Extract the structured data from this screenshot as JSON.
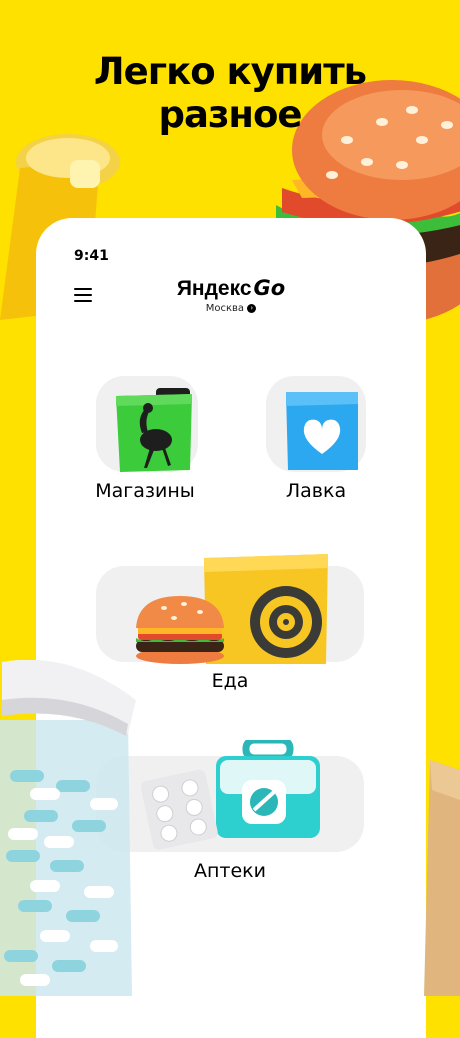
{
  "headline": {
    "line1": "Легко купить",
    "line2": "разное"
  },
  "status": {
    "time": "9:41"
  },
  "header": {
    "brand_name": "Яндекс",
    "brand_suffix": "Go",
    "city": "Москва"
  },
  "services": [
    {
      "id": "stores",
      "label": "Магазины"
    },
    {
      "id": "lavka",
      "label": "Лавка"
    },
    {
      "id": "food",
      "label": "Еда"
    },
    {
      "id": "pharmacy",
      "label": "Аптеки"
    }
  ],
  "colors": {
    "brand_yellow": "#FFE100",
    "tile_bg": "#F0F0F1",
    "stores_green": "#3BCB3B",
    "lavka_blue": "#2CA8F1",
    "pharmacy_teal": "#2ECFCF"
  },
  "icons": [
    "menu-icon",
    "chevron-right-icon",
    "ostrich-bag-icon",
    "lavka-heart-bag-icon",
    "burger-icon",
    "delivery-box-icon",
    "first-aid-kit-icon",
    "pills-blister-icon"
  ]
}
